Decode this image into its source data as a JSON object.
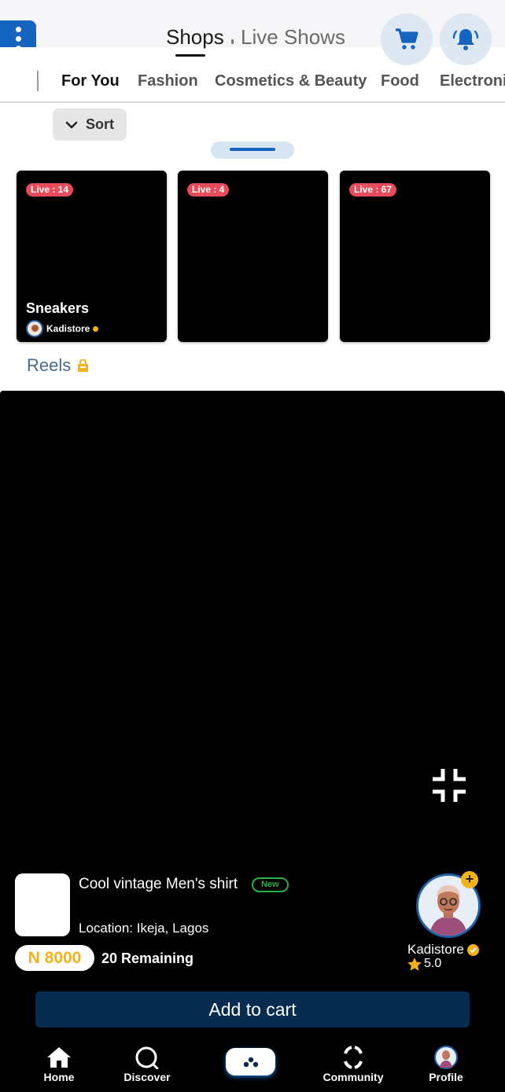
{
  "header": {
    "tabs": [
      "Shops",
      "Live Shows"
    ],
    "active_tab": "Shops"
  },
  "categories": [
    {
      "label": "For You",
      "active": true
    },
    {
      "label": "Fashion",
      "active": false
    },
    {
      "label": "Cosmetics & Beauty",
      "active": false
    },
    {
      "label": "Food",
      "active": false
    },
    {
      "label": "Electronic",
      "active": false
    }
  ],
  "sort": {
    "label": "Sort"
  },
  "live_cards": [
    {
      "badge": "Live : 14",
      "title": "Sneakers",
      "store": "Kadistore"
    },
    {
      "badge": "Live : 4",
      "title": "",
      "store": ""
    },
    {
      "badge": "Live : 67",
      "title": "",
      "store": ""
    }
  ],
  "reels": {
    "label": "Reels"
  },
  "product": {
    "name": "Cool vintage Men's shirt",
    "badge": "New",
    "location": "Location: Ikeja, Lagos",
    "price": "N 8000",
    "remaining": "20 Remaining"
  },
  "seller": {
    "name": "Kadistore",
    "rating": "5.0"
  },
  "add_to_cart": "Add to cart",
  "bottom_nav": [
    {
      "label": "Home",
      "icon": "home-icon"
    },
    {
      "label": "Discover",
      "icon": "search-icon"
    },
    {
      "label": "",
      "icon": "gamepad-icon"
    },
    {
      "label": "Community",
      "icon": "community-icon"
    },
    {
      "label": "Profile",
      "icon": "avatar-icon"
    }
  ],
  "colors": {
    "brand": "#1565c0",
    "accent": "#f3b21a",
    "live": "#e84b5a",
    "cta": "#072c4f"
  }
}
